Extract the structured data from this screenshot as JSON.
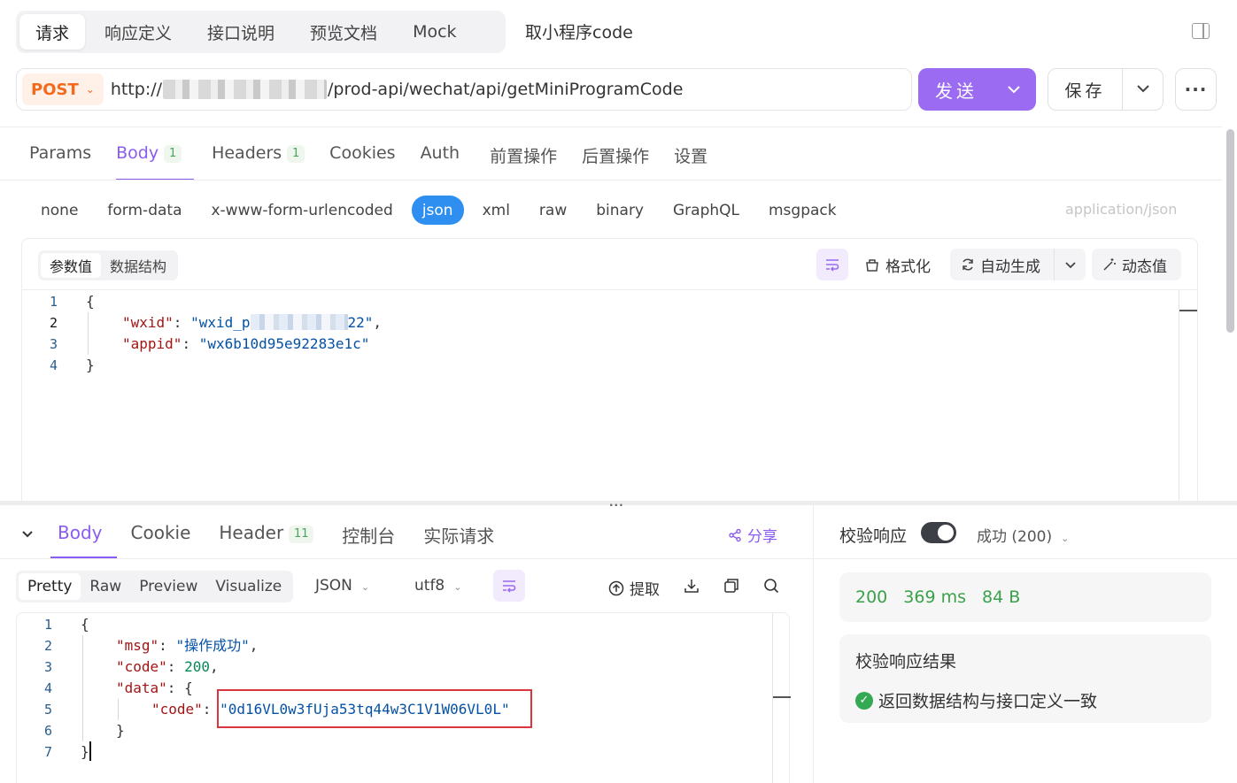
{
  "top_tabs": [
    "请求",
    "响应定义",
    "接口说明",
    "预览文档",
    "Mock"
  ],
  "page_title": "取小程序code",
  "request": {
    "method": "POST",
    "url_prefix": "http://",
    "url_suffix": "/prod-api/wechat/api/getMiniProgramCode",
    "send_label": "发送",
    "save_label": "保存"
  },
  "req_tabs": {
    "params": "Params",
    "body": "Body",
    "body_count": "1",
    "headers": "Headers",
    "headers_count": "1",
    "cookies": "Cookies",
    "auth": "Auth",
    "pre": "前置操作",
    "post": "后置操作",
    "settings": "设置"
  },
  "body_types": [
    "none",
    "form-data",
    "x-www-form-urlencoded",
    "json",
    "xml",
    "raw",
    "binary",
    "GraphQL",
    "msgpack"
  ],
  "content_type": "application/json",
  "editor": {
    "seg_params": "参数值",
    "seg_schema": "数据结构",
    "format": "格式化",
    "autogen": "自动生成",
    "dynamic": "动态值",
    "line_numbers": [
      "1",
      "2",
      "3",
      "4"
    ],
    "open_brace": "{",
    "close_brace": "}",
    "key_wxid": "\"wxid\"",
    "wxid_start": "\"wxid_p",
    "wxid_end": "22\"",
    "key_appid": "\"appid\"",
    "val_appid": "\"wx6b10d95e92283e1c\""
  },
  "resp_tabs": {
    "body": "Body",
    "cookie": "Cookie",
    "header": "Header",
    "header_count": "11",
    "console": "控制台",
    "actual": "实际请求",
    "share": "分享"
  },
  "resp_toolbar": {
    "modes": [
      "Pretty",
      "Raw",
      "Preview",
      "Visualize"
    ],
    "format": "JSON",
    "encoding": "utf8",
    "extract": "提取"
  },
  "response": {
    "line_numbers": [
      "1",
      "2",
      "3",
      "4",
      "5",
      "6",
      "7"
    ],
    "key_msg": "\"msg\"",
    "val_msg": "\"操作成功\"",
    "key_code": "\"code\"",
    "val_code": "200",
    "key_data": "\"data\"",
    "key_inner_code": "\"code\"",
    "val_inner_code": "\"0d16VL0w3fUja53tq44w3C1V1W06VL0L\""
  },
  "verify": {
    "title": "校验响应",
    "status": "成功 (200)",
    "code": "200",
    "time": "369 ms",
    "size": "84 B",
    "result_title": "校验响应结果",
    "result_text": "返回数据结构与接口定义一致"
  },
  "icons": [
    "wrap-icon",
    "format-icon",
    "refresh-icon",
    "magic-wand-icon",
    "share-icon",
    "extract-icon",
    "download-icon",
    "copy-icon",
    "search-icon",
    "check-circle-icon",
    "chevron-down-icon",
    "more-icon",
    "panel-icon"
  ],
  "colors": {
    "accent": "#9b6bf2",
    "method": "#f46a1d",
    "json_active": "#2e8ff0",
    "success": "#3aa14a",
    "highlight_border": "#d9363e"
  }
}
